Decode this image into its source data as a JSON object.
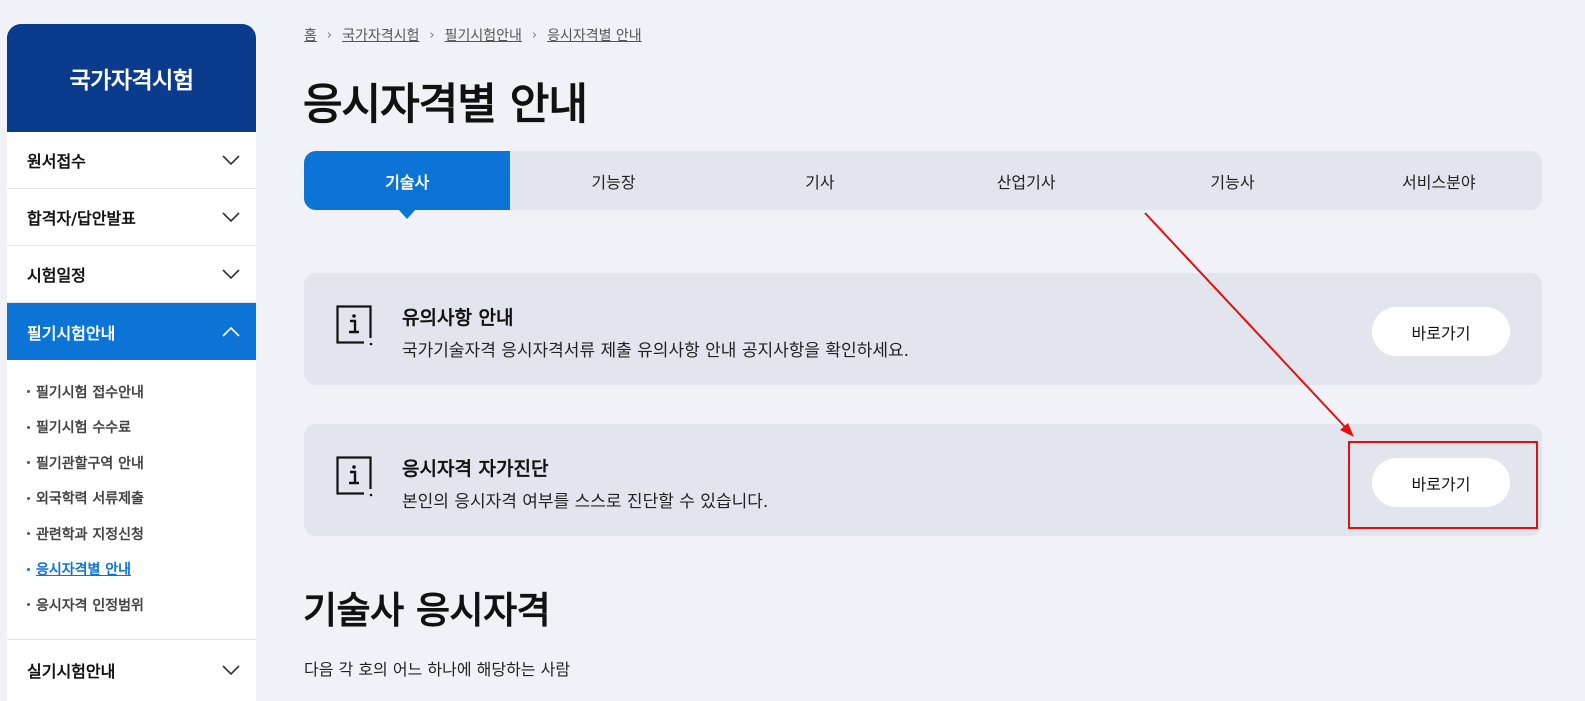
{
  "sidebar": {
    "title": "국가자격시험",
    "menu": [
      {
        "label": "원서접수"
      },
      {
        "label": "합격자/답안발표"
      },
      {
        "label": "시험일정"
      },
      {
        "label": "필기시험안내"
      }
    ],
    "submenu": [
      {
        "label": "필기시험 접수안내"
      },
      {
        "label": "필기시험 수수료"
      },
      {
        "label": "필기관할구역 안내"
      },
      {
        "label": "외국학력 서류제출"
      },
      {
        "label": "관련학과 지정신청"
      },
      {
        "label": "응시자격별 안내"
      },
      {
        "label": "응시자격 인정범위"
      }
    ],
    "last_menu": {
      "label": "실기시험안내"
    }
  },
  "breadcrumb": [
    "홈",
    "국가자격시험",
    "필기시험안내",
    "응시자격별 안내"
  ],
  "page_title": "응시자격별 안내",
  "tabs": [
    {
      "label": "기술사"
    },
    {
      "label": "기능장"
    },
    {
      "label": "기사"
    },
    {
      "label": "산업기사"
    },
    {
      "label": "기능사"
    },
    {
      "label": "서비스분야"
    }
  ],
  "notices": [
    {
      "title": "유의사항 안내",
      "desc": "국가기술자격 응시자격서류 제출 유의사항 안내 공지사항을 확인하세요.",
      "button": "바로가기"
    },
    {
      "title": "응시자격 자가진단",
      "desc": "본인의 응시자격 여부를 스스로 진단할 수 있습니다.",
      "button": "바로가기"
    }
  ],
  "section": {
    "title": "기술사 응시자격",
    "desc": "다음 각 호의 어느 하나에 해당하는 사람"
  },
  "colors": {
    "brand_dark": "#0a3b8c",
    "accent": "#0b74d6",
    "annotation": "#e01010"
  }
}
